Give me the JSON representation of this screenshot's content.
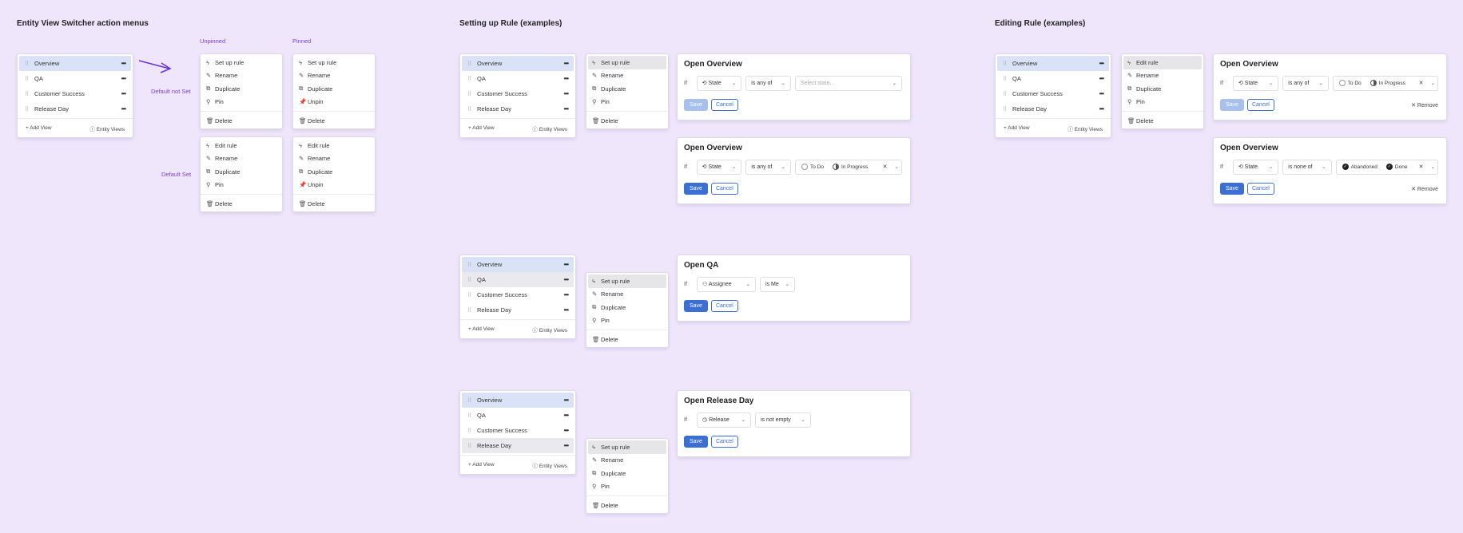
{
  "sections": {
    "a": "Entity View Switcher action menus",
    "b": "Setting up Rule (examples)",
    "c": "Editing Rule (examples)"
  },
  "notes": {
    "unpinned": "Unpinned",
    "pinned": "Pinned",
    "default_not_set": "Default not Set",
    "default_set": "Default Set"
  },
  "switcher": {
    "items": [
      "Overview",
      "QA",
      "Customer Success",
      "Release Day"
    ],
    "add_view": "Add View",
    "entity_views": "Entity Views"
  },
  "menus": {
    "setup": "Set up rule",
    "edit": "Edit rule",
    "rename": "Rename",
    "duplicate": "Duplicate",
    "pin": "Pin",
    "unpin": "Unpin",
    "delete": "Delete"
  },
  "rules": {
    "if": "If",
    "save": "Save",
    "cancel": "Cancel",
    "remove": "Remove",
    "r1": {
      "title": "Open Overview",
      "field": "State",
      "op": "is any of",
      "placeholder": "Select state..."
    },
    "r2": {
      "title": "Open Overview",
      "field": "State",
      "op": "is any of",
      "chips": [
        "To Do",
        "In Progress"
      ]
    },
    "r3": {
      "title": "Open QA",
      "field": "Assignee",
      "op": "is Me"
    },
    "r4": {
      "title": "Open Release Day",
      "field": "Release",
      "op": "is not empty"
    },
    "e1": {
      "title": "Open Overview",
      "field": "State",
      "op": "is any of",
      "chips": [
        "To Do",
        "In Progress"
      ]
    },
    "e2": {
      "title": "Open Overview",
      "field": "State",
      "op": "is none of",
      "chips": [
        "Abandoned",
        "Done"
      ]
    }
  },
  "colors": {
    "background": "#efe6fc",
    "accent": "#3b6fd4",
    "note": "#7b3fd1",
    "arrow": "#6a2fe0",
    "highlight": "#d9e2f7"
  }
}
